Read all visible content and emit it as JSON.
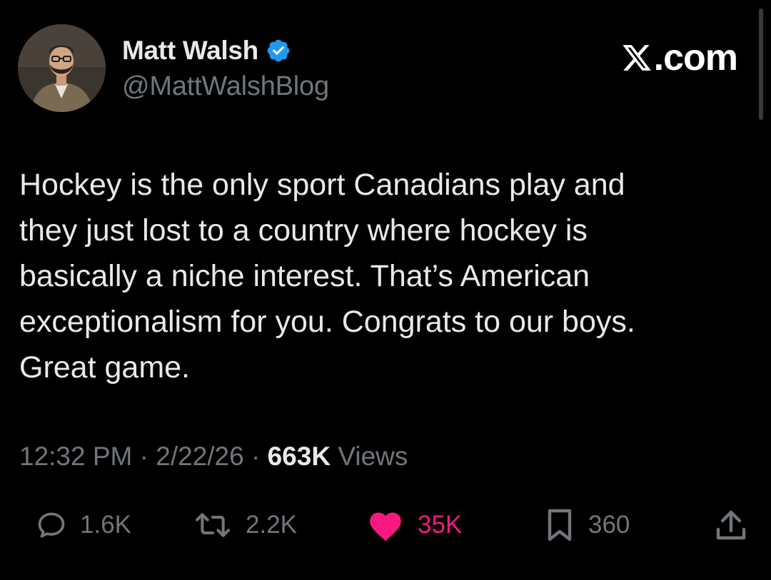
{
  "author": {
    "display_name": "Matt Walsh",
    "handle": "@MattWalshBlog",
    "verified": true,
    "verified_color": "#1d9bf0",
    "avatar_icon": "profile-photo"
  },
  "brand": {
    "text": ".com",
    "logo_icon": "x-logo-icon"
  },
  "tweet": {
    "text": "Hockey is the only sport Canadians play and\nthey just lost to a country where hockey is\nbasically a niche interest. That’s American\nexceptionalism for you. Congrats to our boys.\nGreat game."
  },
  "meta": {
    "time": "12:32 PM",
    "separator": "·",
    "date": "2/22/26",
    "views_count": "663K",
    "views_label": "Views"
  },
  "actions": {
    "replies": {
      "icon": "reply-icon",
      "count": "1.6K"
    },
    "reposts": {
      "icon": "repost-icon",
      "count": "2.2K"
    },
    "likes": {
      "icon": "heart-icon",
      "count": "35K",
      "liked": true,
      "color": "#f91880"
    },
    "bookmarks": {
      "icon": "bookmark-icon",
      "count": "360"
    },
    "share": {
      "icon": "share-icon"
    }
  },
  "colors": {
    "background": "#000000",
    "primary_text": "#e7e9ea",
    "secondary_text": "#71767b",
    "like": "#f91880",
    "verified": "#1d9bf0"
  }
}
